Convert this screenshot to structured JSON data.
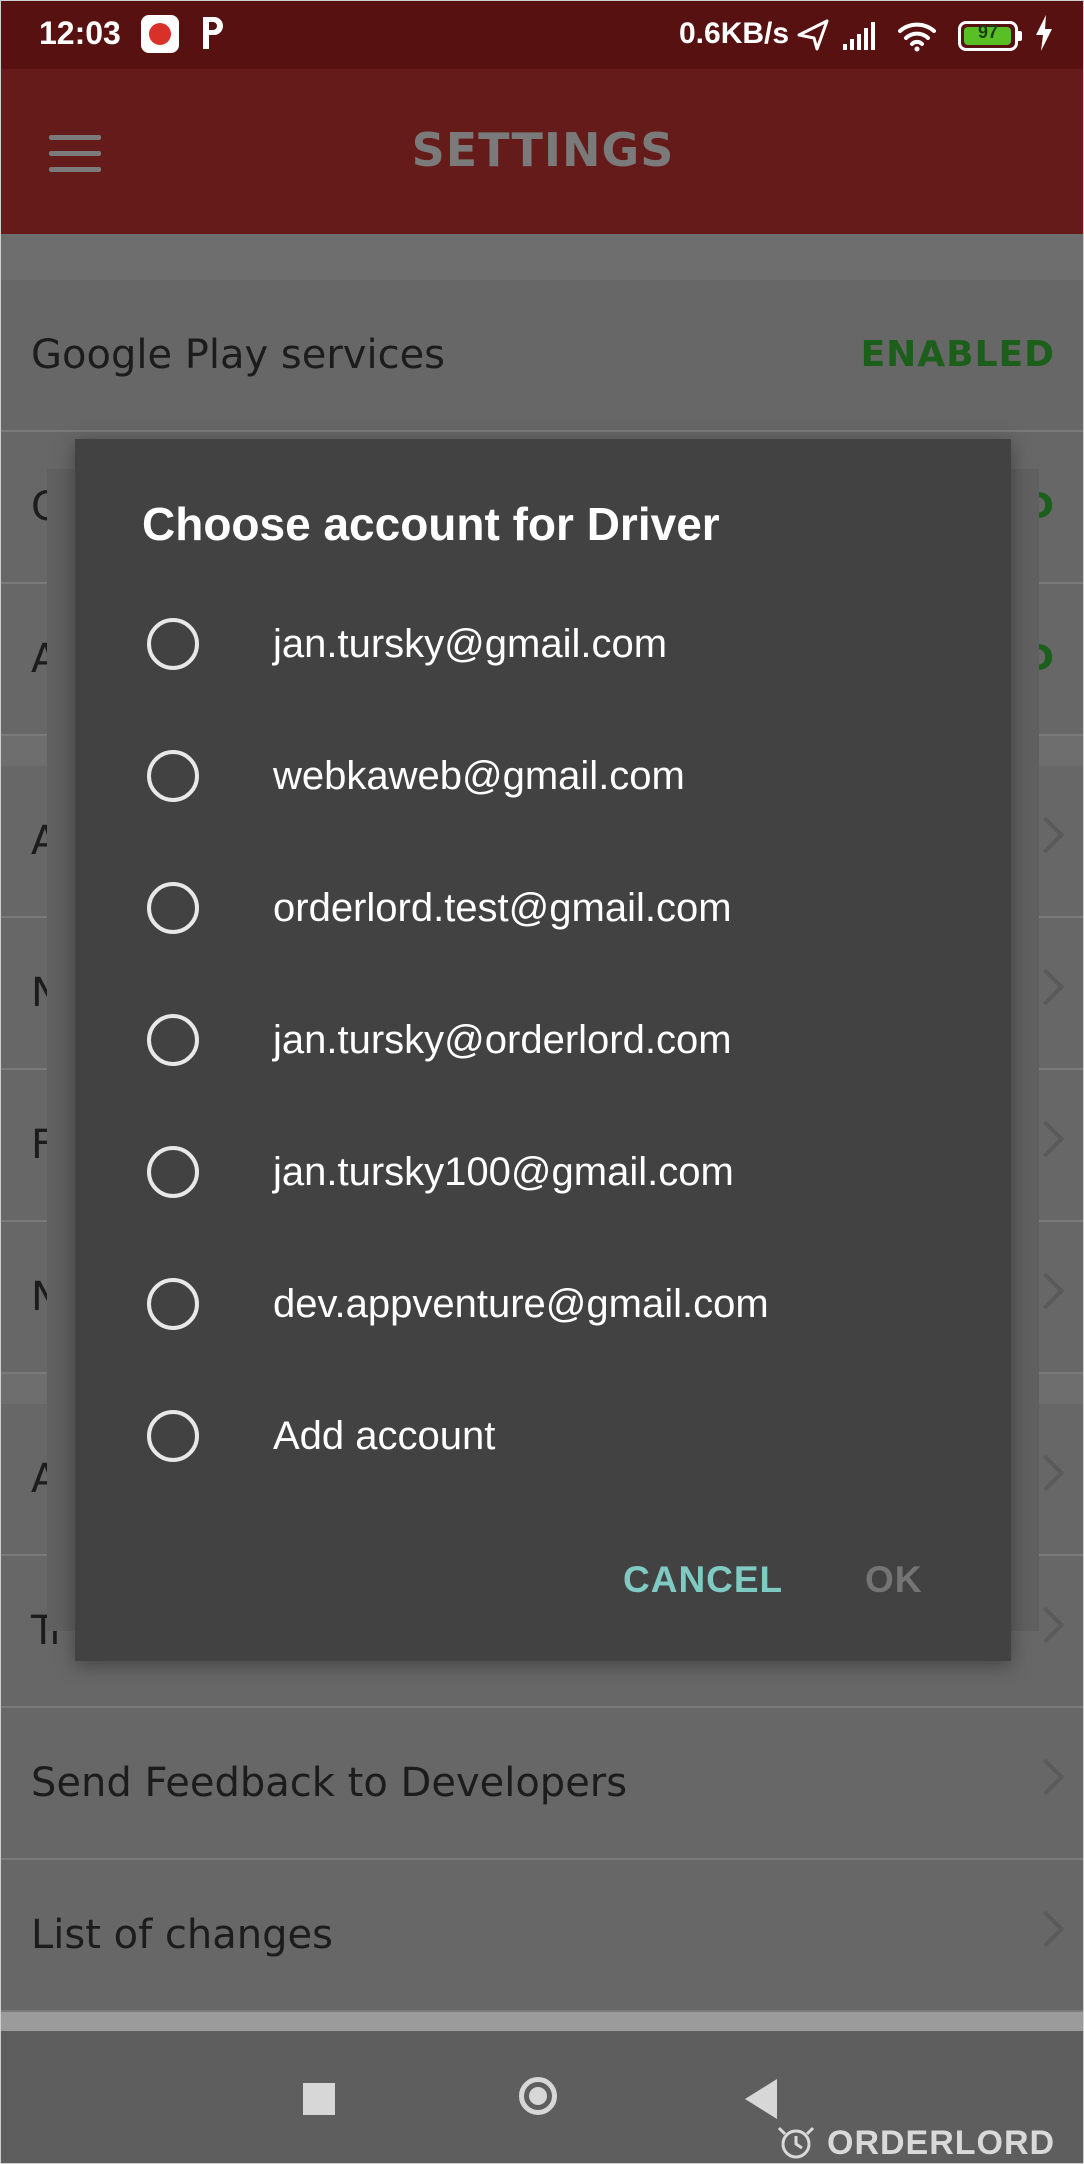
{
  "status_bar": {
    "time": "12:03",
    "net_speed": "0.6KB/s",
    "battery": "97",
    "battery_level": 0.97,
    "icons": [
      "app-notification-icon",
      "p-notification-icon",
      "location-arrow-icon",
      "signal-icon",
      "wifi-icon",
      "battery-icon",
      "charging-bolt-icon"
    ]
  },
  "toolbar": {
    "title": "SETTINGS",
    "menu_icon": "hamburger-menu-icon"
  },
  "settings": {
    "rows": [
      {
        "label": "Google Play services",
        "status": "ENABLED"
      },
      {
        "label": "C",
        "status": "D"
      },
      {
        "label": "A",
        "status": "D"
      },
      {
        "label": "A"
      },
      {
        "label": "N"
      },
      {
        "label": "F"
      },
      {
        "label": "N"
      },
      {
        "label": "A"
      },
      {
        "label": "Tr"
      },
      {
        "label": "Send Feedback to Developers"
      },
      {
        "label": "List of changes"
      }
    ]
  },
  "dialog": {
    "title": "Choose account for Driver",
    "options": [
      "jan.tursky@gmail.com",
      "webkaweb@gmail.com",
      "orderlord.test@gmail.com",
      "jan.tursky@orderlord.com",
      "jan.tursky100@gmail.com",
      "dev.appventure@gmail.com",
      "Add account"
    ],
    "cancel": "CANCEL",
    "ok": "OK"
  },
  "watermark": "ORDERLORD",
  "colors": {
    "status_bar": "#561110",
    "toolbar": "#651b1a",
    "dialog": "#424242",
    "accent": "#7fcbc4",
    "enabled": "#1b5f1b"
  }
}
